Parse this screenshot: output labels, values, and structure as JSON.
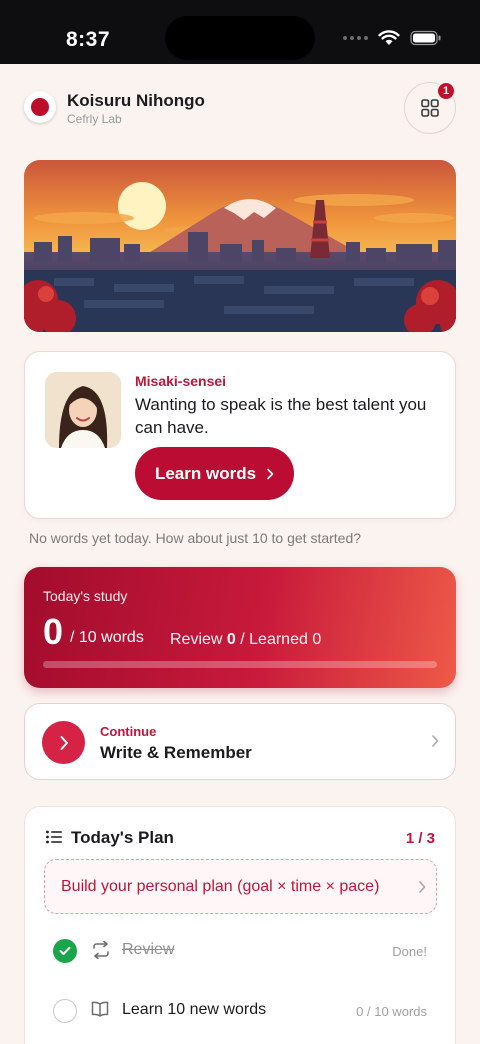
{
  "status_bar": {
    "time": "8:37"
  },
  "header": {
    "title": "Koisuru Nihongo",
    "subtitle": "Cefrly Lab",
    "notification_count": "1"
  },
  "sensei": {
    "name": "Misaki-sensei",
    "quote": "Wanting to speak is the best talent you can have.",
    "button_label": "Learn words"
  },
  "hint": "No words yet today. How about just 10 to get started?",
  "study": {
    "label": "Today's study",
    "count": "0",
    "total": "/ 10 words",
    "review_prefix": "Review ",
    "review_value": "0",
    "learned_text": " / Learned 0",
    "progress": 0
  },
  "continue": {
    "kicker": "Continue",
    "title": "Write & Remember"
  },
  "plan": {
    "title": "Today's Plan",
    "count": "1 / 3",
    "build_label": "Build your personal plan (goal × time × pace)",
    "items": [
      {
        "label": "Review",
        "status": "Done!",
        "done": true,
        "icon": "repeat-icon"
      },
      {
        "label": "Learn 10 new words",
        "status": "0 / 10 words",
        "done": false,
        "icon": "book-icon"
      }
    ]
  },
  "colors": {
    "accent": "#c0163a",
    "button": "#bb0d33",
    "success": "#1aa54a",
    "background": "#fbf3f0"
  }
}
